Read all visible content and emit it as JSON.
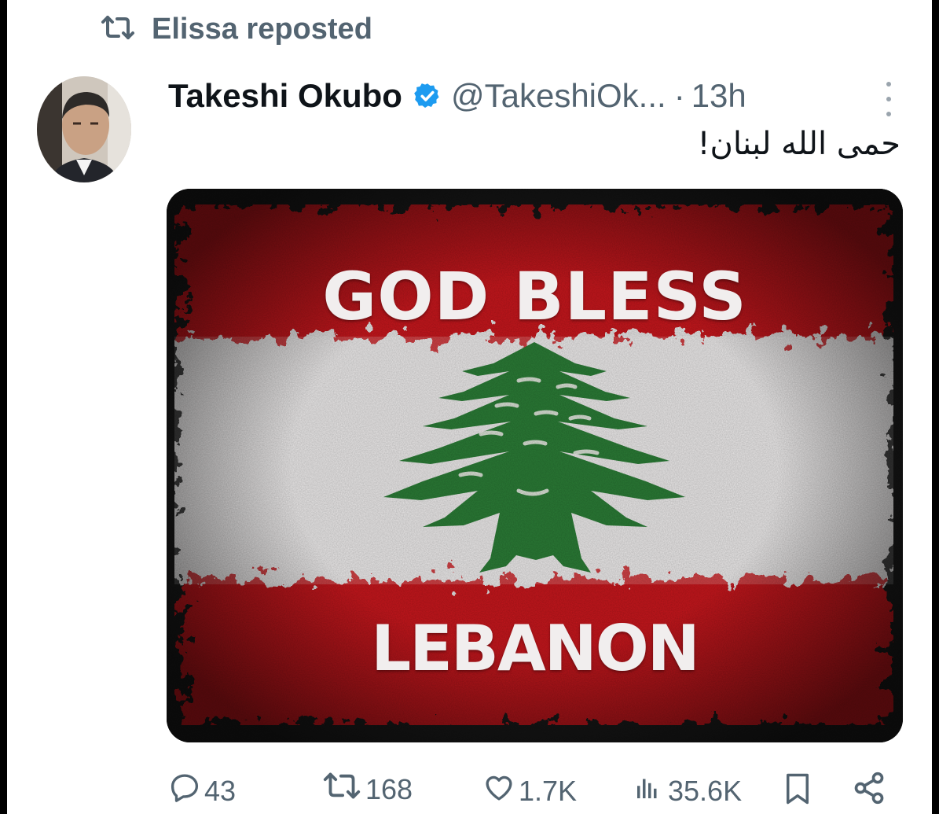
{
  "repost": {
    "icon": "repost-icon",
    "label": "Elissa reposted"
  },
  "tweet": {
    "author_name": "Takeshi Okubo",
    "verified": true,
    "handle": "@TakeshiOk...",
    "separator": "·",
    "time": "13h",
    "text": "حمى الله لبنان!"
  },
  "media": {
    "headline_top": "GOD BLESS",
    "headline_bottom": "LEBANON",
    "colors": {
      "red": "#c3191f",
      "white": "#e4e2e2",
      "cedar": "#2a7a35"
    }
  },
  "actions": {
    "replies": "43",
    "reposts": "168",
    "likes": "1.7K",
    "views": "35.6K"
  },
  "colors": {
    "muted": "#536471",
    "text": "#0f1419",
    "verified": "#1d9bf0"
  }
}
